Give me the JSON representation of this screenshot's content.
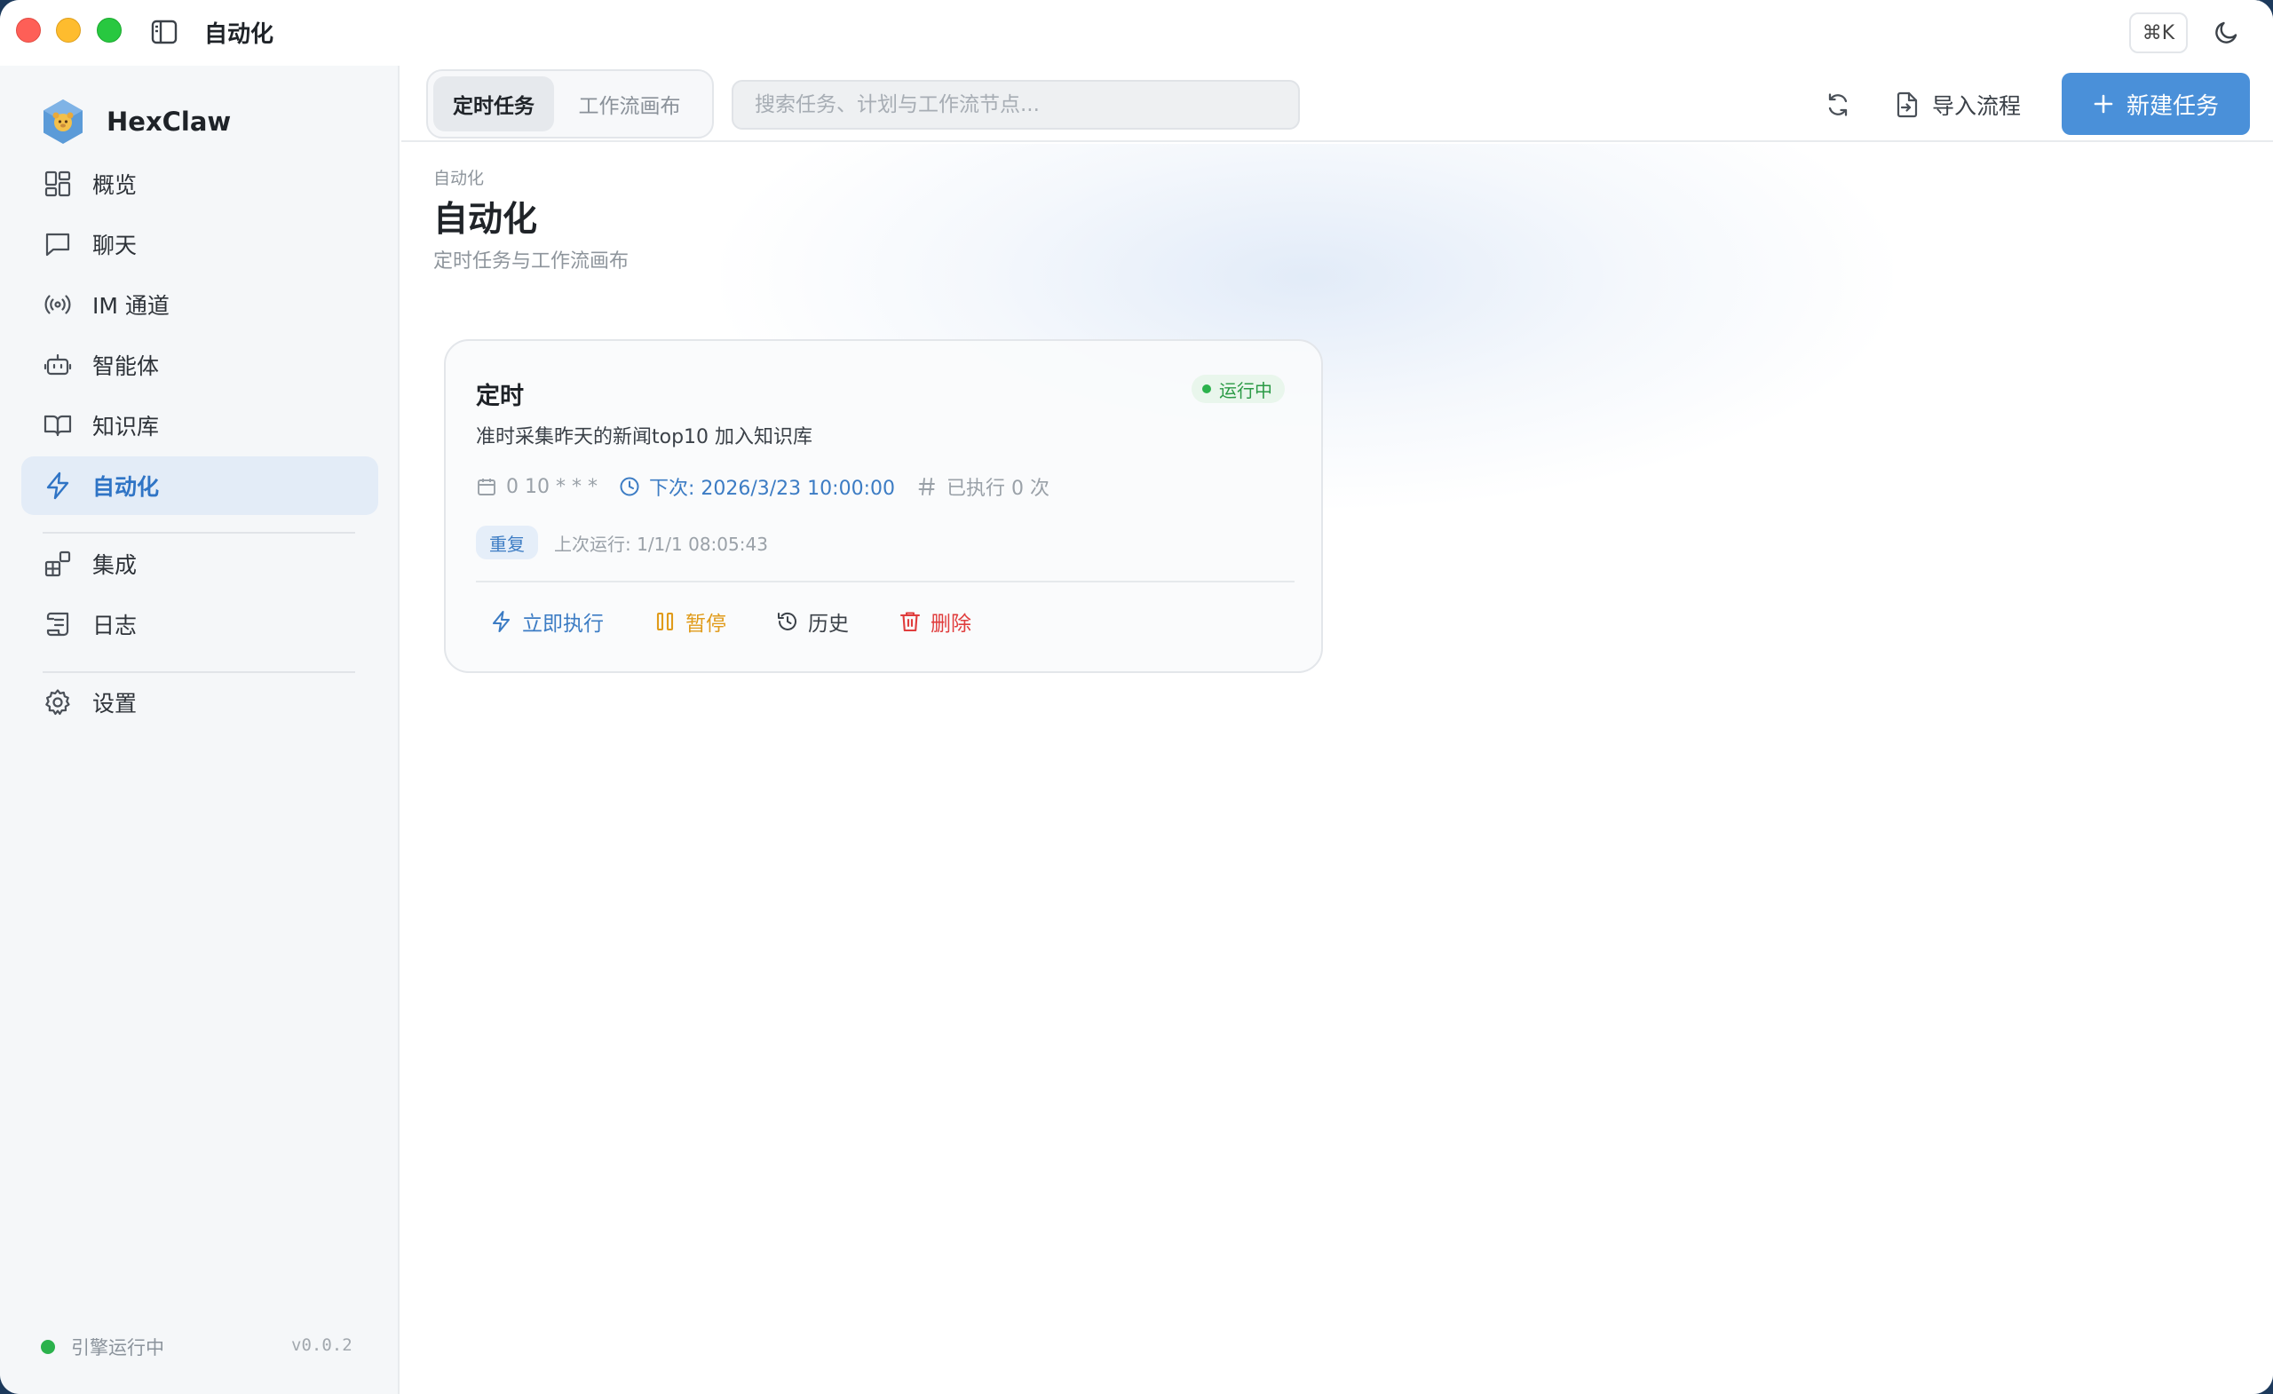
{
  "window": {
    "title": "自动化"
  },
  "header": {
    "shortcut": "⌘K"
  },
  "sidebar": {
    "brand": "HexClaw",
    "items": [
      {
        "label": "概览",
        "icon": "dashboard-icon"
      },
      {
        "label": "聊天",
        "icon": "chat-icon"
      },
      {
        "label": "IM 通道",
        "icon": "broadcast-icon"
      },
      {
        "label": "智能体",
        "icon": "robot-icon"
      },
      {
        "label": "知识库",
        "icon": "book-icon"
      },
      {
        "label": "自动化",
        "icon": "lightning-icon",
        "active": true
      },
      {
        "label": "集成",
        "icon": "blocks-icon"
      },
      {
        "label": "日志",
        "icon": "scroll-icon"
      },
      {
        "label": "设置",
        "icon": "gear-icon"
      }
    ],
    "engine_status": "引擎运行中",
    "version": "v0.0.2"
  },
  "toolbar": {
    "tabs": [
      {
        "label": "定时任务",
        "active": true
      },
      {
        "label": "工作流画布",
        "active": false
      }
    ],
    "search_placeholder": "搜索任务、计划与工作流节点...",
    "import_label": "导入流程",
    "new_task_label": "新建任务"
  },
  "page": {
    "breadcrumb": "自动化",
    "title": "自动化",
    "subtitle": "定时任务与工作流画布"
  },
  "tasks": [
    {
      "name": "定时",
      "status": "运行中",
      "description": "准时采集昨天的新闻top10 加入知识库",
      "cron": "0 10 * * *",
      "next_run": "下次: 2026/3/23 10:00:00",
      "exec_count": "已执行 0 次",
      "tag": "重复",
      "last_run": "上次运行: 1/1/1 08:05:43",
      "actions": {
        "run": "立即执行",
        "pause": "暂停",
        "history": "历史",
        "delete": "删除"
      }
    }
  ],
  "colors": {
    "accent": "#4a90d9",
    "active_text": "#2f74c5",
    "success": "#2bb24c",
    "warning": "#e09b1a",
    "danger": "#e03d3d"
  }
}
